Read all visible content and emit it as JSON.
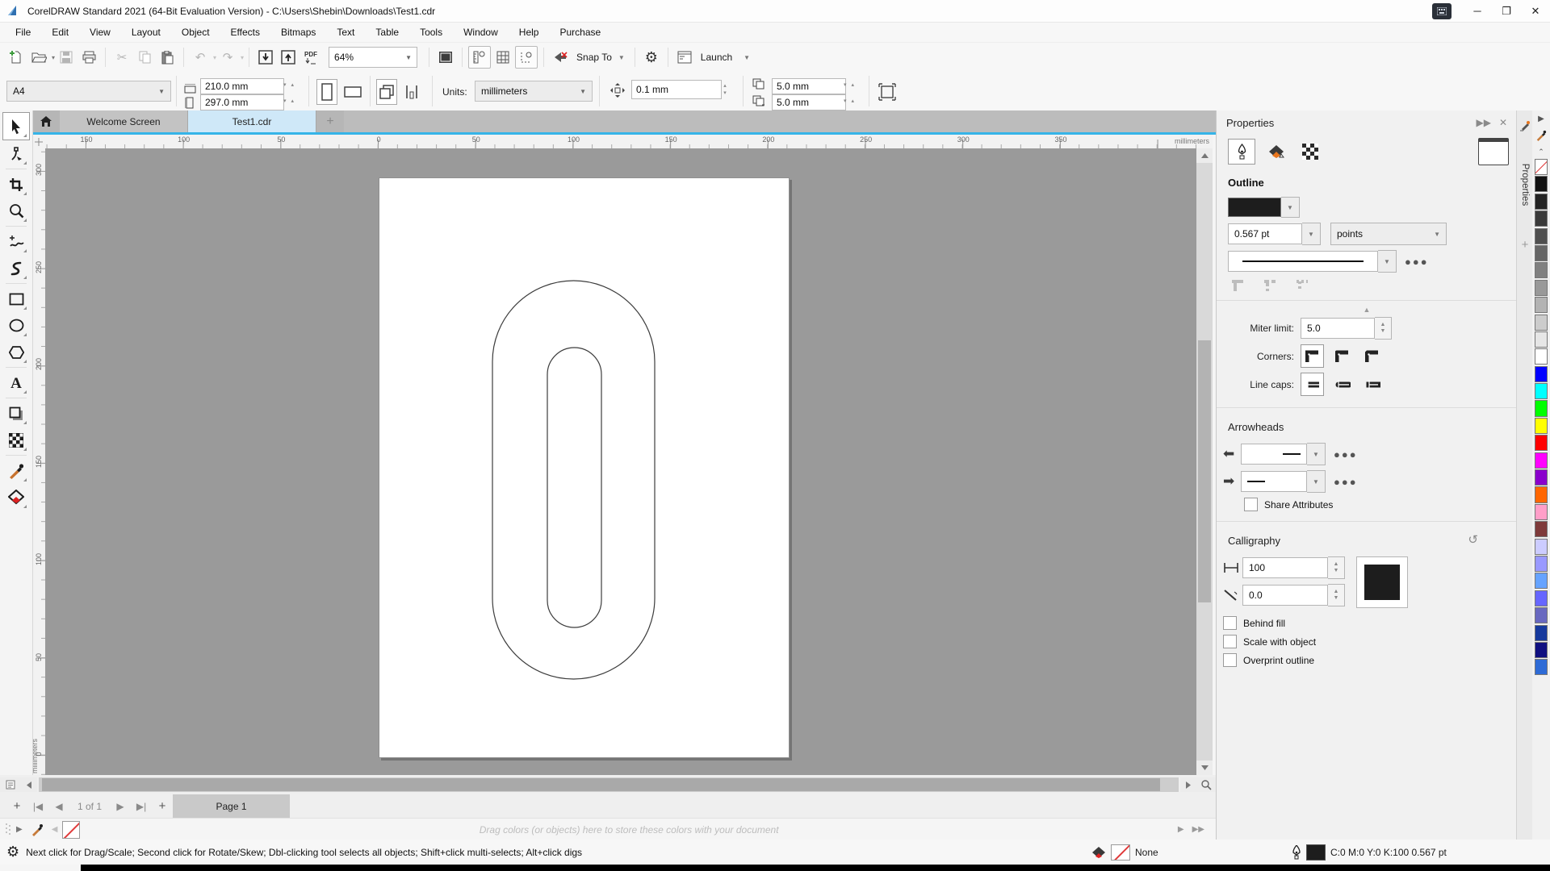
{
  "titlebar": {
    "title": "CorelDRAW Standard 2021 (64-Bit Evaluation Version) - C:\\Users\\Shebin\\Downloads\\Test1.cdr",
    "minimize": "─",
    "restore": "❐",
    "close": "✕"
  },
  "menus": [
    "File",
    "Edit",
    "View",
    "Layout",
    "Object",
    "Effects",
    "Bitmaps",
    "Text",
    "Table",
    "Tools",
    "Window",
    "Help",
    "Purchase"
  ],
  "toolbar": {
    "zoom_level": "64%",
    "snap_to_label": "Snap To",
    "launch_label": "Launch",
    "pdf_label": "PDF",
    "undo_glyph": "↶",
    "redo_glyph": "↷",
    "cut_glyph": "✂",
    "options_glyph": "⚙"
  },
  "property_bar": {
    "preset": "A4",
    "page_width": "210.0 mm",
    "page_height": "297.0 mm",
    "units_label": "Units:",
    "units_value": "millimeters",
    "nudge_distance": "0.1 mm",
    "duplicate_x": "5.0 mm",
    "duplicate_y": "5.0 mm"
  },
  "tabs": {
    "items": [
      {
        "label": "Welcome Screen",
        "active": false
      },
      {
        "label": "Test1.cdr",
        "active": true
      }
    ],
    "new_tab_glyph": "+"
  },
  "rulers": {
    "horizontal_labels": [
      "150",
      "100",
      "50",
      "0",
      "50",
      "100",
      "150",
      "200",
      "250",
      "300",
      "350"
    ],
    "horizontal_unit": "millimeters",
    "vertical_labels": [
      "300",
      "250",
      "200",
      "150",
      "100",
      "50",
      "0"
    ],
    "vertical_unit": "millimeters"
  },
  "toolbox": {
    "tools": [
      {
        "icon": "pick-tool",
        "selected": true
      },
      {
        "icon": "shape-tool"
      },
      {
        "separator": true
      },
      {
        "icon": "crop-tool"
      },
      {
        "icon": "zoom-tool"
      },
      {
        "separator": true
      },
      {
        "icon": "freehand-tool"
      },
      {
        "icon": "artistic-media-tool"
      },
      {
        "separator": true
      },
      {
        "icon": "rectangle-tool"
      },
      {
        "icon": "ellipse-tool"
      },
      {
        "icon": "polygon-tool"
      },
      {
        "separator": true
      },
      {
        "icon": "text-tool"
      },
      {
        "separator": true
      },
      {
        "icon": "drop-shadow-tool"
      },
      {
        "icon": "transparency-tool"
      },
      {
        "separator": true
      },
      {
        "icon": "color-eyedropper-tool"
      },
      {
        "icon": "interactive-fill-tool"
      }
    ]
  },
  "page_bar": {
    "counter": "1 of 1",
    "page_tab": "Page 1",
    "add_glyph": "+",
    "first_glyph": "|◀",
    "prev_glyph": "◀",
    "next_glyph": "▶",
    "last_glyph": "▶|"
  },
  "document_palette": {
    "hint": "Drag colors (or objects) here to store these colors with your document"
  },
  "status_bar": {
    "message": "Next click for Drag/Scale; Second click for Rotate/Skew; Dbl-clicking tool selects all objects; Shift+click multi-selects; Alt+click digs",
    "fill_value": "None",
    "outline_info": "C:0 M:0 Y:0 K:100  0.567 pt"
  },
  "properties_panel": {
    "title": "Properties",
    "vertical_tab": "Properties",
    "outline": {
      "heading": "Outline",
      "width_value": "0.567 pt",
      "width_unit": "points",
      "miter_label": "Miter limit:",
      "miter_value": "5.0",
      "corners_label": "Corners:",
      "line_caps_label": "Line caps:"
    },
    "arrowheads": {
      "heading": "Arrowheads",
      "share_label": "Share Attributes"
    },
    "calligraphy": {
      "heading": "Calligraphy",
      "stretch_value": "100",
      "angle_value": "0.0",
      "behind_fill": "Behind fill",
      "scale_with_object": "Scale with object",
      "overprint_outline": "Overprint outline"
    }
  },
  "palette": {
    "swatches": [
      {
        "name": "no-color",
        "none": true
      },
      {
        "name": "black",
        "color": "#111111"
      },
      {
        "name": "90-black",
        "color": "#232323"
      },
      {
        "name": "80-black",
        "color": "#3a3a3a"
      },
      {
        "name": "70-black",
        "color": "#4f4f4f"
      },
      {
        "name": "60-black",
        "color": "#666666"
      },
      {
        "name": "50-black",
        "color": "#808080"
      },
      {
        "name": "40-black",
        "color": "#999999"
      },
      {
        "name": "30-black",
        "color": "#b3b3b3"
      },
      {
        "name": "20-black",
        "color": "#cccccc"
      },
      {
        "name": "10-black",
        "color": "#e6e6e6"
      },
      {
        "name": "white",
        "color": "#ffffff"
      },
      {
        "name": "blue",
        "color": "#0000ff"
      },
      {
        "name": "cyan",
        "color": "#00ffff"
      },
      {
        "name": "green",
        "color": "#00ff00"
      },
      {
        "name": "yellow",
        "color": "#ffff00"
      },
      {
        "name": "red",
        "color": "#ff0000"
      },
      {
        "name": "magenta",
        "color": "#ff00ff"
      },
      {
        "name": "purple",
        "color": "#8a00cc"
      },
      {
        "name": "orange",
        "color": "#ff6600"
      },
      {
        "name": "pink",
        "color": "#ff9ec8"
      },
      {
        "name": "brown",
        "color": "#7e3a3a"
      },
      {
        "name": "pale-lavender",
        "color": "#ccccff"
      },
      {
        "name": "periwinkle",
        "color": "#9999ff"
      },
      {
        "name": "light-blue",
        "color": "#66a3ff"
      },
      {
        "name": "blue-violet",
        "color": "#6666ff"
      },
      {
        "name": "slate-blue",
        "color": "#6868c0"
      },
      {
        "name": "dark-blue",
        "color": "#16399d"
      },
      {
        "name": "navy",
        "color": "#101080"
      },
      {
        "name": "royal-blue",
        "color": "#2e6bd6"
      }
    ]
  },
  "colors": {
    "tab_accent_line": "#35b4e8",
    "active_tab_bg": "#cfe8f8",
    "desktop_gray": "#9a9a9a",
    "outline_swatch": "#1a1a1a",
    "status_strip": "#000000"
  }
}
